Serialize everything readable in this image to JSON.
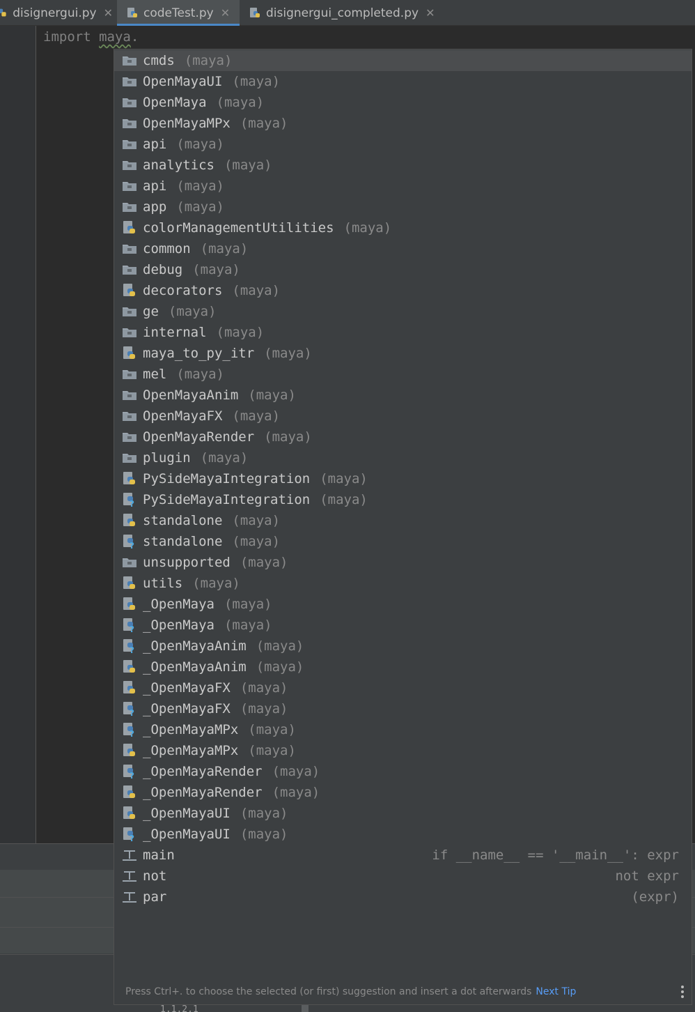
{
  "tabs": [
    {
      "label": "disignergui.py",
      "active": false
    },
    {
      "label": "codeTest.py",
      "active": true
    },
    {
      "label": "disignergui_completed.py",
      "active": false
    }
  ],
  "editor": {
    "code_keyword": "import",
    "code_module": "maya",
    "code_dot": "."
  },
  "completion": {
    "items": [
      {
        "name": "cmds",
        "ctx": "(maya)",
        "icon": "package-icon",
        "selected": true
      },
      {
        "name": "OpenMayaUI",
        "ctx": "(maya)",
        "icon": "package-icon"
      },
      {
        "name": "OpenMaya",
        "ctx": "(maya)",
        "icon": "package-icon"
      },
      {
        "name": "OpenMayaMPx",
        "ctx": "(maya)",
        "icon": "package-icon"
      },
      {
        "name": "api",
        "ctx": "(maya)",
        "icon": "package-icon"
      },
      {
        "name": "analytics",
        "ctx": "(maya)",
        "icon": "package-icon"
      },
      {
        "name": "api",
        "ctx": "(maya)",
        "icon": "package-icon"
      },
      {
        "name": "app",
        "ctx": "(maya)",
        "icon": "package-icon"
      },
      {
        "name": "colorManagementUtilities",
        "ctx": "(maya)",
        "icon": "python-file-icon"
      },
      {
        "name": "common",
        "ctx": "(maya)",
        "icon": "package-icon"
      },
      {
        "name": "debug",
        "ctx": "(maya)",
        "icon": "package-icon"
      },
      {
        "name": "decorators",
        "ctx": "(maya)",
        "icon": "python-file-icon"
      },
      {
        "name": "ge",
        "ctx": "(maya)",
        "icon": "package-icon"
      },
      {
        "name": "internal",
        "ctx": "(maya)",
        "icon": "package-icon"
      },
      {
        "name": "maya_to_py_itr",
        "ctx": "(maya)",
        "icon": "python-file-icon"
      },
      {
        "name": "mel",
        "ctx": "(maya)",
        "icon": "package-icon"
      },
      {
        "name": "OpenMayaAnim",
        "ctx": "(maya)",
        "icon": "package-icon"
      },
      {
        "name": "OpenMayaFX",
        "ctx": "(maya)",
        "icon": "package-icon"
      },
      {
        "name": "OpenMayaRender",
        "ctx": "(maya)",
        "icon": "package-icon"
      },
      {
        "name": "plugin",
        "ctx": "(maya)",
        "icon": "package-icon"
      },
      {
        "name": "PySideMayaIntegration",
        "ctx": "(maya)",
        "icon": "python-file-icon"
      },
      {
        "name": "PySideMayaIntegration",
        "ctx": "(maya)",
        "icon": "python-stub-icon"
      },
      {
        "name": "standalone",
        "ctx": "(maya)",
        "icon": "python-file-icon"
      },
      {
        "name": "standalone",
        "ctx": "(maya)",
        "icon": "python-stub-icon"
      },
      {
        "name": "unsupported",
        "ctx": "(maya)",
        "icon": "package-icon"
      },
      {
        "name": "utils",
        "ctx": "(maya)",
        "icon": "python-file-icon"
      },
      {
        "name": "_OpenMaya",
        "ctx": "(maya)",
        "icon": "python-file-icon"
      },
      {
        "name": "_OpenMaya",
        "ctx": "(maya)",
        "icon": "python-stub-icon"
      },
      {
        "name": "_OpenMayaAnim",
        "ctx": "(maya)",
        "icon": "python-stub-icon"
      },
      {
        "name": "_OpenMayaAnim",
        "ctx": "(maya)",
        "icon": "python-file-icon"
      },
      {
        "name": "_OpenMayaFX",
        "ctx": "(maya)",
        "icon": "python-file-icon"
      },
      {
        "name": "_OpenMayaFX",
        "ctx": "(maya)",
        "icon": "python-stub-icon"
      },
      {
        "name": "_OpenMayaMPx",
        "ctx": "(maya)",
        "icon": "python-stub-icon"
      },
      {
        "name": "_OpenMayaMPx",
        "ctx": "(maya)",
        "icon": "python-file-icon"
      },
      {
        "name": "_OpenMayaRender",
        "ctx": "(maya)",
        "icon": "python-stub-icon"
      },
      {
        "name": "_OpenMayaRender",
        "ctx": "(maya)",
        "icon": "python-file-icon"
      },
      {
        "name": "_OpenMayaUI",
        "ctx": "(maya)",
        "icon": "python-file-icon"
      },
      {
        "name": "_OpenMayaUI",
        "ctx": "(maya)",
        "icon": "python-stub-icon"
      },
      {
        "name": "main",
        "ctx": "",
        "tail": "if __name__ == '__main__': expr",
        "icon": "live-template-icon"
      },
      {
        "name": "not",
        "ctx": "",
        "tail": "not expr",
        "icon": "live-template-icon"
      },
      {
        "name": "par",
        "ctx": "",
        "tail": "(expr)",
        "icon": "live-template-icon"
      }
    ],
    "footer_hint": "Press Ctrl+. to choose the selected (or first) suggestion and insert a dot afterwards",
    "next_tip": "Next Tip"
  },
  "colors": {
    "accent": "#4a88c7",
    "popup_bg": "#3c3f41",
    "selected_bg": "#4b4d4f",
    "link": "#589df6"
  }
}
